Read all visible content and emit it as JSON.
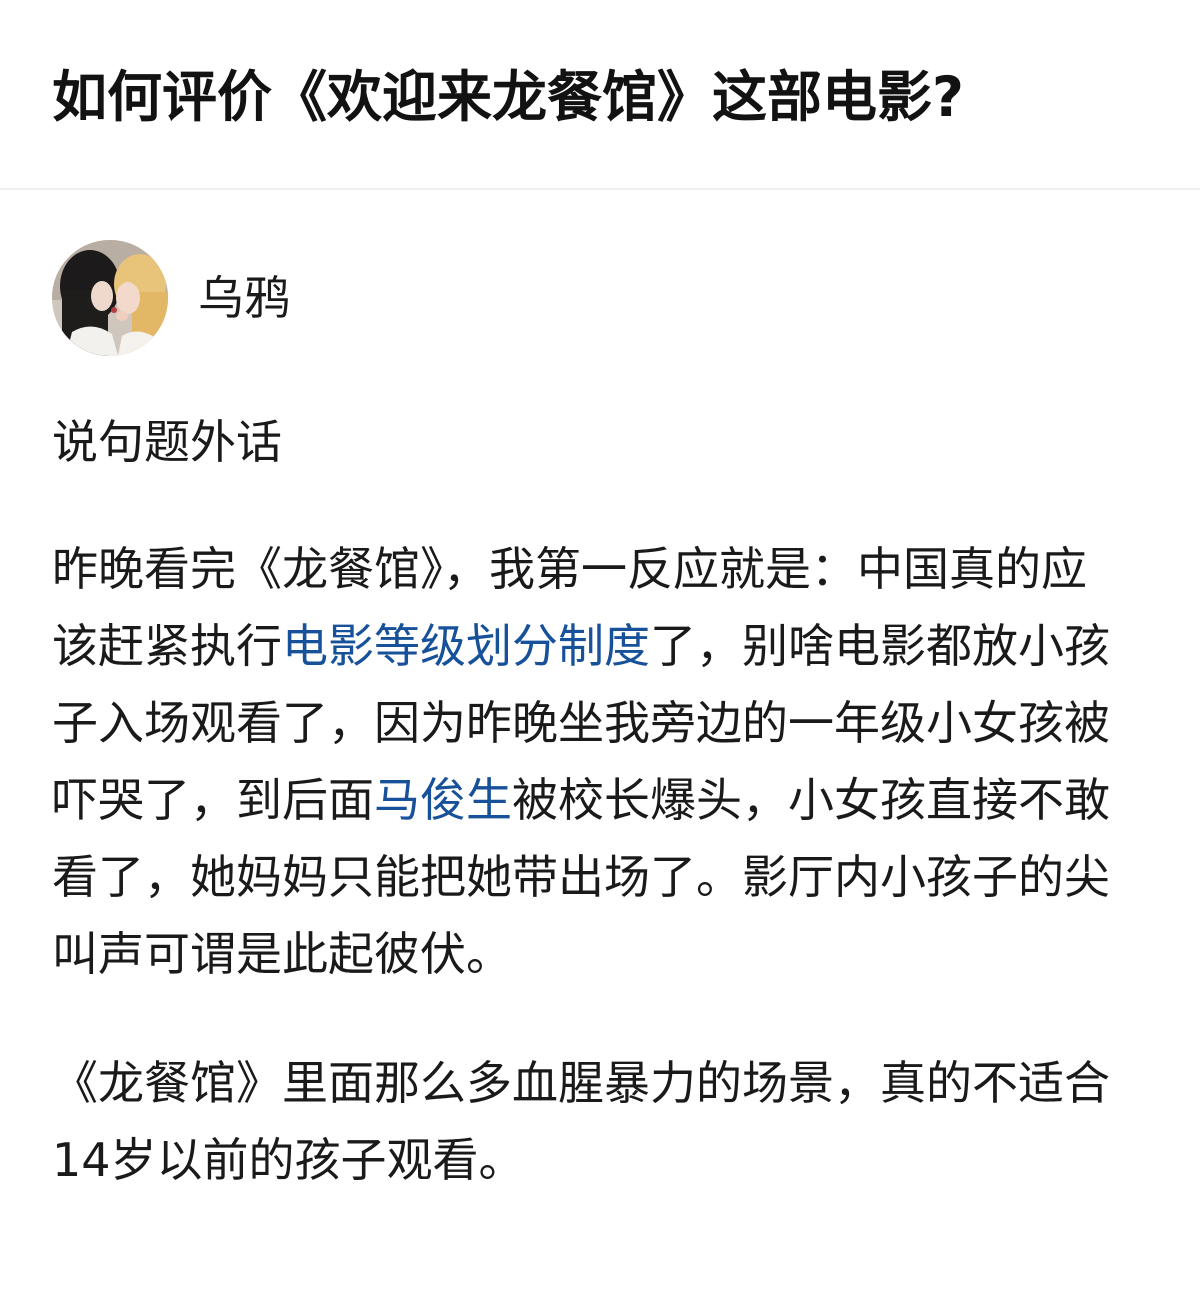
{
  "question": {
    "title": "如何评价《欢迎来龙餐馆》这部电影?"
  },
  "author": {
    "name": "乌鸦",
    "avatar_icon": "avatar-photo"
  },
  "answer": {
    "p1": "说句题外话",
    "p2": {
      "t1": "昨晚看完《龙餐馆》，我第一反应就是：中国真的应该赶紧执行",
      "link1": "电影等级划分制度",
      "t2": "了，别啥电影都放小孩子入场观看了，因为昨晚坐我旁边的一年级小女孩被吓哭了，到后面",
      "link2": "马俊生",
      "t3": "被校长爆头，小女孩直接不敢看了，她妈妈只能把她带出场了。影厅内小孩子的尖叫声可谓是此起彼伏。"
    },
    "p3": "《龙餐馆》里面那么多血腥暴力的场景，真的不适合14岁以前的孩子观看。"
  },
  "colors": {
    "link": "#175199",
    "text": "#1a1a1a",
    "divider": "#f0f0f0"
  }
}
